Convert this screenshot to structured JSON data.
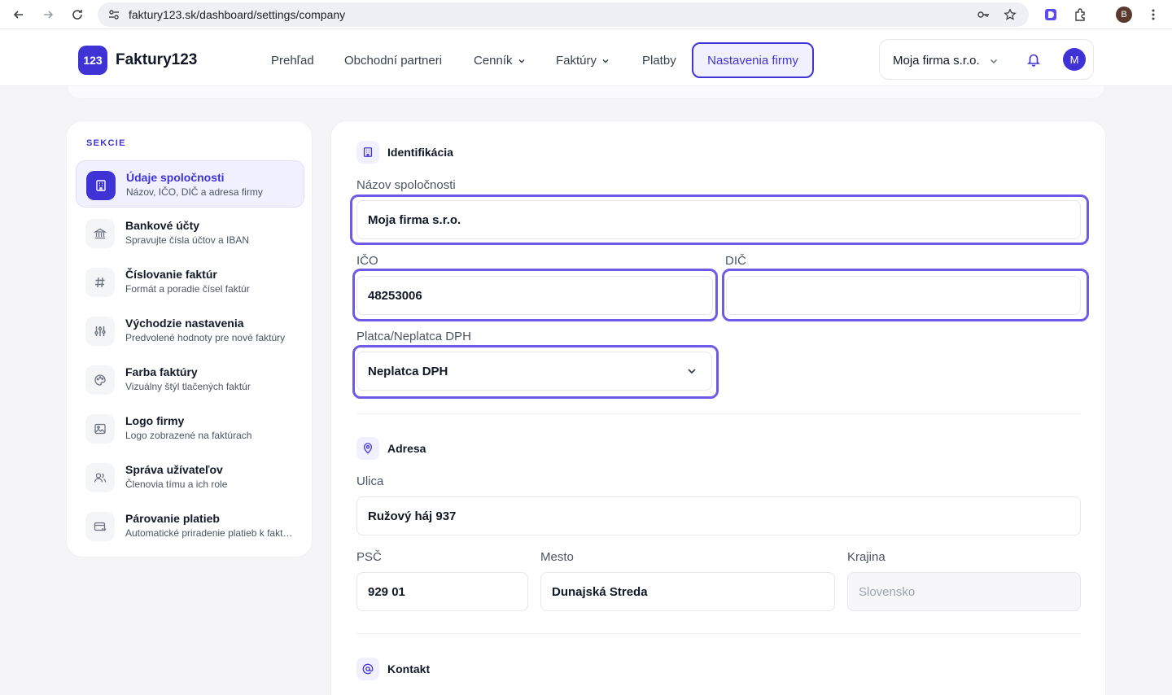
{
  "browser": {
    "url": "faktury123.sk/dashboard/settings/company",
    "profile_initial": "B"
  },
  "header": {
    "logo_badge": "123",
    "logo_text": "Faktury123",
    "nav": {
      "overview": "Prehľad",
      "partners": "Obchodní partneri",
      "pricelist": "Cenník",
      "invoices": "Faktúry",
      "payments": "Platby",
      "settings": "Nastavenia firmy"
    },
    "company_switcher": "Moja firma s.r.o.",
    "user_initial": "M"
  },
  "sidebar": {
    "heading": "SEKCIE",
    "items": [
      {
        "title": "Údaje spoločnosti",
        "subtitle": "Názov, IČO, DIČ a adresa firmy",
        "icon": "building-icon"
      },
      {
        "title": "Bankové účty",
        "subtitle": "Spravujte čísla účtov a IBAN",
        "icon": "bank-icon"
      },
      {
        "title": "Číslovanie faktúr",
        "subtitle": "Formát a poradie čísel faktúr",
        "icon": "hash-icon"
      },
      {
        "title": "Východzie nastavenia",
        "subtitle": "Predvolené hodnoty pre nové faktúry",
        "icon": "sliders-icon"
      },
      {
        "title": "Farba faktúry",
        "subtitle": "Vizuálny štýl tlačených faktúr",
        "icon": "palette-icon"
      },
      {
        "title": "Logo firmy",
        "subtitle": "Logo zobrazené na faktúrach",
        "icon": "image-icon"
      },
      {
        "title": "Správa užívateľov",
        "subtitle": "Členovia tímu a ich role",
        "icon": "users-icon"
      },
      {
        "title": "Párovanie platieb",
        "subtitle": "Automatické priradenie platieb k faktúram",
        "icon": "card-icon"
      }
    ]
  },
  "identification": {
    "title": "Identifikácia",
    "company_name_label": "Názov spoločnosti",
    "company_name_value": "Moja firma s.r.o.",
    "ico_label": "IČO",
    "ico_value": "48253006",
    "dic_label": "DIČ",
    "dic_value": "",
    "vat_label": "Platca/Neplatca DPH",
    "vat_value": "Neplatca DPH"
  },
  "address": {
    "title": "Adresa",
    "street_label": "Ulica",
    "street_value": "Ružový háj 937",
    "zip_label": "PSČ",
    "zip_value": "929 01",
    "city_label": "Mesto",
    "city_value": "Dunajská Streda",
    "country_label": "Krajina",
    "country_value": "Slovensko"
  },
  "contact": {
    "title": "Kontakt"
  }
}
